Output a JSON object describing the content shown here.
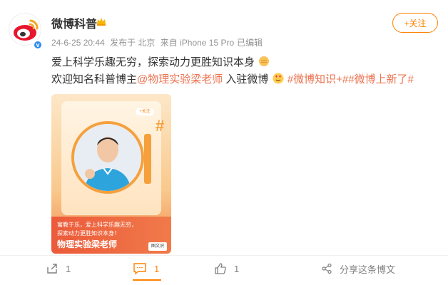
{
  "header": {
    "username": "微博科普",
    "timestamp": "24-6-25 20:44",
    "published_from": "发布于 北京",
    "device": "来自 iPhone 15 Pro",
    "edited": "已编辑",
    "follow_label": "+关注"
  },
  "post": {
    "line1": "爱上科学乐趣无穷，探索动力更胜知识本身",
    "line2_prefix": "欢迎知名科普博主",
    "mention": "@物理实验梁老师",
    "line2_middle": " 入驻微博",
    "hashtags": "#微博知识+##微博上新了#"
  },
  "media": {
    "small_follow": "+关注",
    "caption_line1": "寓教于乐，爱上科学乐趣无穷，",
    "caption_line2": "探索动力更胜知识本身！",
    "caption_title": "物理实验梁老师",
    "badge": "图文识"
  },
  "actions": {
    "repost_count": "1",
    "comment_count": "1",
    "like_count": "1",
    "share_label": "分享这条博文"
  },
  "colors": {
    "accent": "#ff8200",
    "link": "#eb7350",
    "meta": "#939393"
  }
}
